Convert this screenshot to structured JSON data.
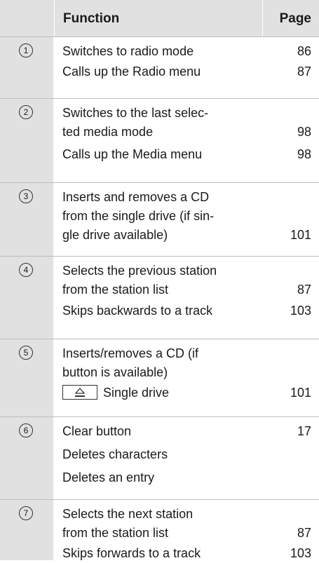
{
  "header": {
    "function": "Function",
    "page": "Page"
  },
  "groups": [
    {
      "num": "1",
      "rows": [
        {
          "text": "Switches to radio mode",
          "page": "86"
        },
        {
          "text": "Calls up the Radio menu",
          "page": "87"
        }
      ]
    },
    {
      "num": "2",
      "rows": [
        {
          "line1": "Switches to the last selec-",
          "line2": "ted media mode",
          "page": "98"
        },
        {
          "text": "Calls up the Media menu",
          "page": "98"
        }
      ]
    },
    {
      "num": "3",
      "rows": [
        {
          "line1": "Inserts and removes a CD",
          "line2": "from the single drive (if sin-",
          "line3": "gle drive available)",
          "page": "101"
        }
      ]
    },
    {
      "num": "4",
      "rows": [
        {
          "line1": "Selects the previous station",
          "line2": "from the station list",
          "page": "87"
        },
        {
          "text": "Skips backwards to a track",
          "page": "103"
        }
      ]
    },
    {
      "num": "5",
      "rows": [
        {
          "line1": "Inserts/removes a CD (if",
          "line2": "button is available)"
        },
        {
          "text": "Single drive",
          "page": "101",
          "icon": "eject-key-icon"
        }
      ]
    },
    {
      "num": "6",
      "rows": [
        {
          "text": "Clear button",
          "page": "17"
        },
        {
          "text": "Deletes characters"
        },
        {
          "text": "Deletes an entry"
        }
      ]
    },
    {
      "num": "7",
      "rows": [
        {
          "line1": "Selects the next station",
          "line2": "from the station list",
          "page": "87"
        },
        {
          "text": "Skips forwards to a track",
          "page": "103"
        }
      ]
    }
  ]
}
